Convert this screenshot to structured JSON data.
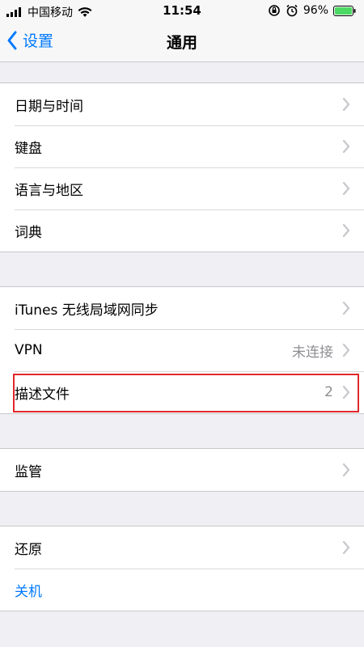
{
  "status_bar": {
    "carrier": "中国移动",
    "time": "11:54",
    "battery": "96%"
  },
  "nav": {
    "back_label": "设置",
    "title": "通用"
  },
  "groups": [
    {
      "rows": [
        {
          "label": "日期与时间",
          "detail": ""
        },
        {
          "label": "键盘",
          "detail": ""
        },
        {
          "label": "语言与地区",
          "detail": ""
        },
        {
          "label": "词典",
          "detail": ""
        }
      ]
    },
    {
      "rows": [
        {
          "label": "iTunes 无线局域网同步",
          "detail": ""
        },
        {
          "label": "VPN",
          "detail": "未连接"
        },
        {
          "label": "描述文件",
          "detail": "2"
        }
      ]
    },
    {
      "rows": [
        {
          "label": "监管",
          "detail": ""
        }
      ]
    },
    {
      "rows": [
        {
          "label": "还原",
          "detail": ""
        },
        {
          "label": "关机",
          "detail": ""
        }
      ]
    }
  ],
  "colors": {
    "accent": "#007aff",
    "highlight": "#e0282a"
  }
}
